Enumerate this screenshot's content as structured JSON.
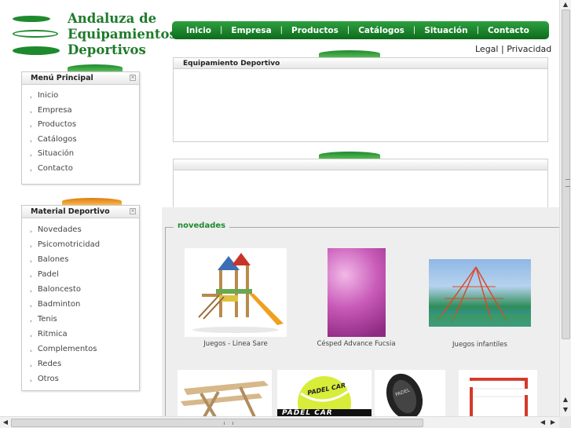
{
  "logo": {
    "line1": "Andaluza de",
    "line2": "Equipamientos",
    "line3": "Deportivos"
  },
  "nav": {
    "items": [
      "Inicio",
      "Empresa",
      "Productos",
      "Catálogos",
      "Situación",
      "Contacto"
    ],
    "separator": "|"
  },
  "legal": {
    "legal": "Legal",
    "sep": "|",
    "privacy": "Privacidad"
  },
  "menu_principal": {
    "title": "Menú Principal",
    "items": [
      "Inicio",
      "Empresa",
      "Productos",
      "Catálogos",
      "Situación",
      "Contacto"
    ]
  },
  "material_deportivo": {
    "title": "Material Deportivo",
    "items": [
      "Novedades",
      "Psicomotricidad",
      "Balones",
      "Padel",
      "Baloncesto",
      "Badminton",
      "Tenis",
      "Ritmica",
      "Complementos",
      "Redes",
      "Otros"
    ]
  },
  "panel1": {
    "title": "Equipamiento Deportivo"
  },
  "novedades": {
    "legend": "novedades",
    "products": [
      {
        "caption": "Juegos - Linea Sare",
        "icon": "playground-slide-image"
      },
      {
        "caption": "Césped Advance Fucsia",
        "icon": "artificial-grass-image"
      },
      {
        "caption": "Juegos infantiles",
        "icon": "rope-climbing-image"
      },
      {
        "caption": "",
        "icon": "picnic-table-image"
      },
      {
        "caption": "",
        "icon": "padel-ball-image"
      },
      {
        "caption": "",
        "icon": "padel-racket-image"
      },
      {
        "caption": "",
        "icon": "goal-net-image"
      }
    ],
    "padel_brand": "PADEL CAR"
  },
  "colors": {
    "brand_green": "#1e8a2e",
    "accent_orange": "#e07a10"
  }
}
